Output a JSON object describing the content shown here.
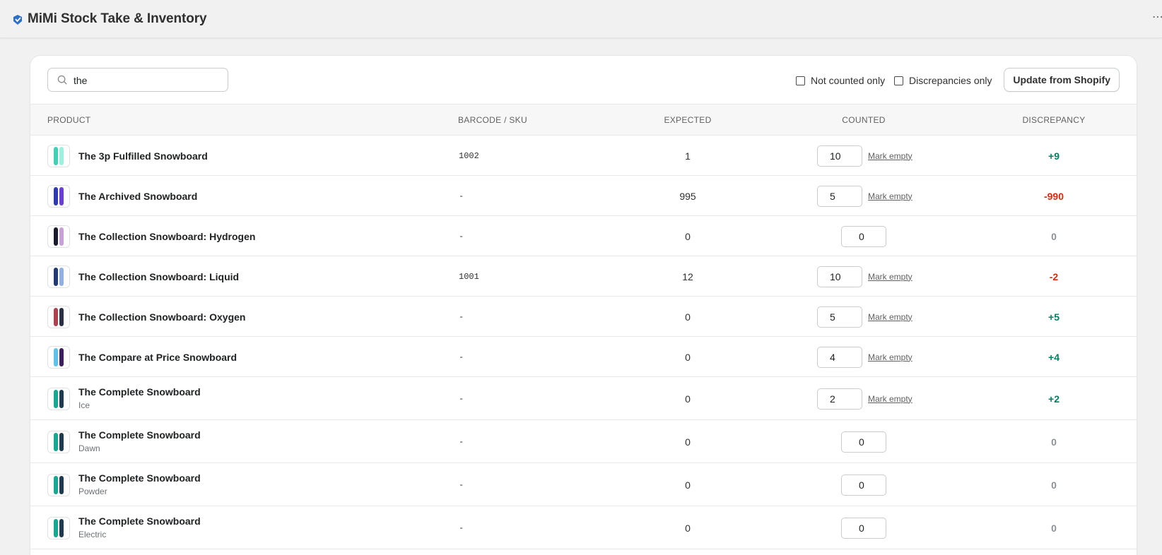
{
  "app": {
    "title": "MiMi Stock Take & Inventory",
    "more_icon": "⋯"
  },
  "toolbar": {
    "search_value": "the",
    "filter_not_counted": "Not counted only",
    "filter_discrepancies": "Discrepancies only",
    "update_button": "Update from Shopify"
  },
  "table": {
    "headers": {
      "product": "Product",
      "barcode": "Barcode / SKU",
      "expected": "Expected",
      "counted": "Counted",
      "discrepancy": "Discrepancy"
    },
    "mark_empty_label": "Mark empty",
    "rows": [
      {
        "name": "The 3p Fulfilled Snowboard",
        "variant": "",
        "sku": "1002",
        "expected": "1",
        "counted": "10",
        "mark_empty": true,
        "discrepancy": "+9",
        "status": "positive"
      },
      {
        "name": "The Archived Snowboard",
        "variant": "",
        "sku": "-",
        "expected": "995",
        "counted": "5",
        "mark_empty": true,
        "discrepancy": "-990",
        "status": "negative"
      },
      {
        "name": "The Collection Snowboard: Hydrogen",
        "variant": "",
        "sku": "-",
        "expected": "0",
        "counted": "0",
        "mark_empty": false,
        "discrepancy": "0",
        "status": "neutral"
      },
      {
        "name": "The Collection Snowboard: Liquid",
        "variant": "",
        "sku": "1001",
        "expected": "12",
        "counted": "10",
        "mark_empty": true,
        "discrepancy": "-2",
        "status": "negative"
      },
      {
        "name": "The Collection Snowboard: Oxygen",
        "variant": "",
        "sku": "-",
        "expected": "0",
        "counted": "5",
        "mark_empty": true,
        "discrepancy": "+5",
        "status": "positive"
      },
      {
        "name": "The Compare at Price Snowboard",
        "variant": "",
        "sku": "-",
        "expected": "0",
        "counted": "4",
        "mark_empty": true,
        "discrepancy": "+4",
        "status": "positive"
      },
      {
        "name": "The Complete Snowboard",
        "variant": "Ice",
        "sku": "-",
        "expected": "0",
        "counted": "2",
        "mark_empty": true,
        "discrepancy": "+2",
        "status": "positive"
      },
      {
        "name": "The Complete Snowboard",
        "variant": "Dawn",
        "sku": "-",
        "expected": "0",
        "counted": "0",
        "mark_empty": false,
        "discrepancy": "0",
        "status": "neutral"
      },
      {
        "name": "The Complete Snowboard",
        "variant": "Powder",
        "sku": "-",
        "expected": "0",
        "counted": "0",
        "mark_empty": false,
        "discrepancy": "0",
        "status": "neutral"
      },
      {
        "name": "The Complete Snowboard",
        "variant": "Electric",
        "sku": "-",
        "expected": "0",
        "counted": "0",
        "mark_empty": false,
        "discrepancy": "0",
        "status": "neutral"
      }
    ]
  },
  "colors": {
    "positive": "#008060",
    "negative": "#d72c0d",
    "neutral": "#8c9196",
    "brand": "#2c6ecb"
  },
  "thumbnails": [
    {
      "icon": "snowboard-icon",
      "colors": [
        "#3fd1b5",
        "#9ef0de"
      ]
    },
    {
      "icon": "snowboard-icon",
      "colors": [
        "#2f3bb0",
        "#6a3fd8"
      ]
    },
    {
      "icon": "snowboard-icon",
      "colors": [
        "#1b1b2e",
        "#c9a0d6"
      ]
    },
    {
      "icon": "snowboard-icon",
      "colors": [
        "#223a74",
        "#8fb0e0"
      ]
    },
    {
      "icon": "snowboard-icon",
      "colors": [
        "#b0414f",
        "#2a2f45"
      ]
    },
    {
      "icon": "snowboard-icon",
      "colors": [
        "#5fc2e8",
        "#3a1f5c"
      ]
    },
    {
      "icon": "snowboard-icon",
      "colors": [
        "#16a890",
        "#1d3a4f"
      ]
    },
    {
      "icon": "snowboard-icon",
      "colors": [
        "#16a890",
        "#1d3a4f"
      ]
    },
    {
      "icon": "snowboard-icon",
      "colors": [
        "#16a890",
        "#1d3a4f"
      ]
    },
    {
      "icon": "snowboard-icon",
      "colors": [
        "#16a890",
        "#1d3a4f"
      ]
    }
  ]
}
